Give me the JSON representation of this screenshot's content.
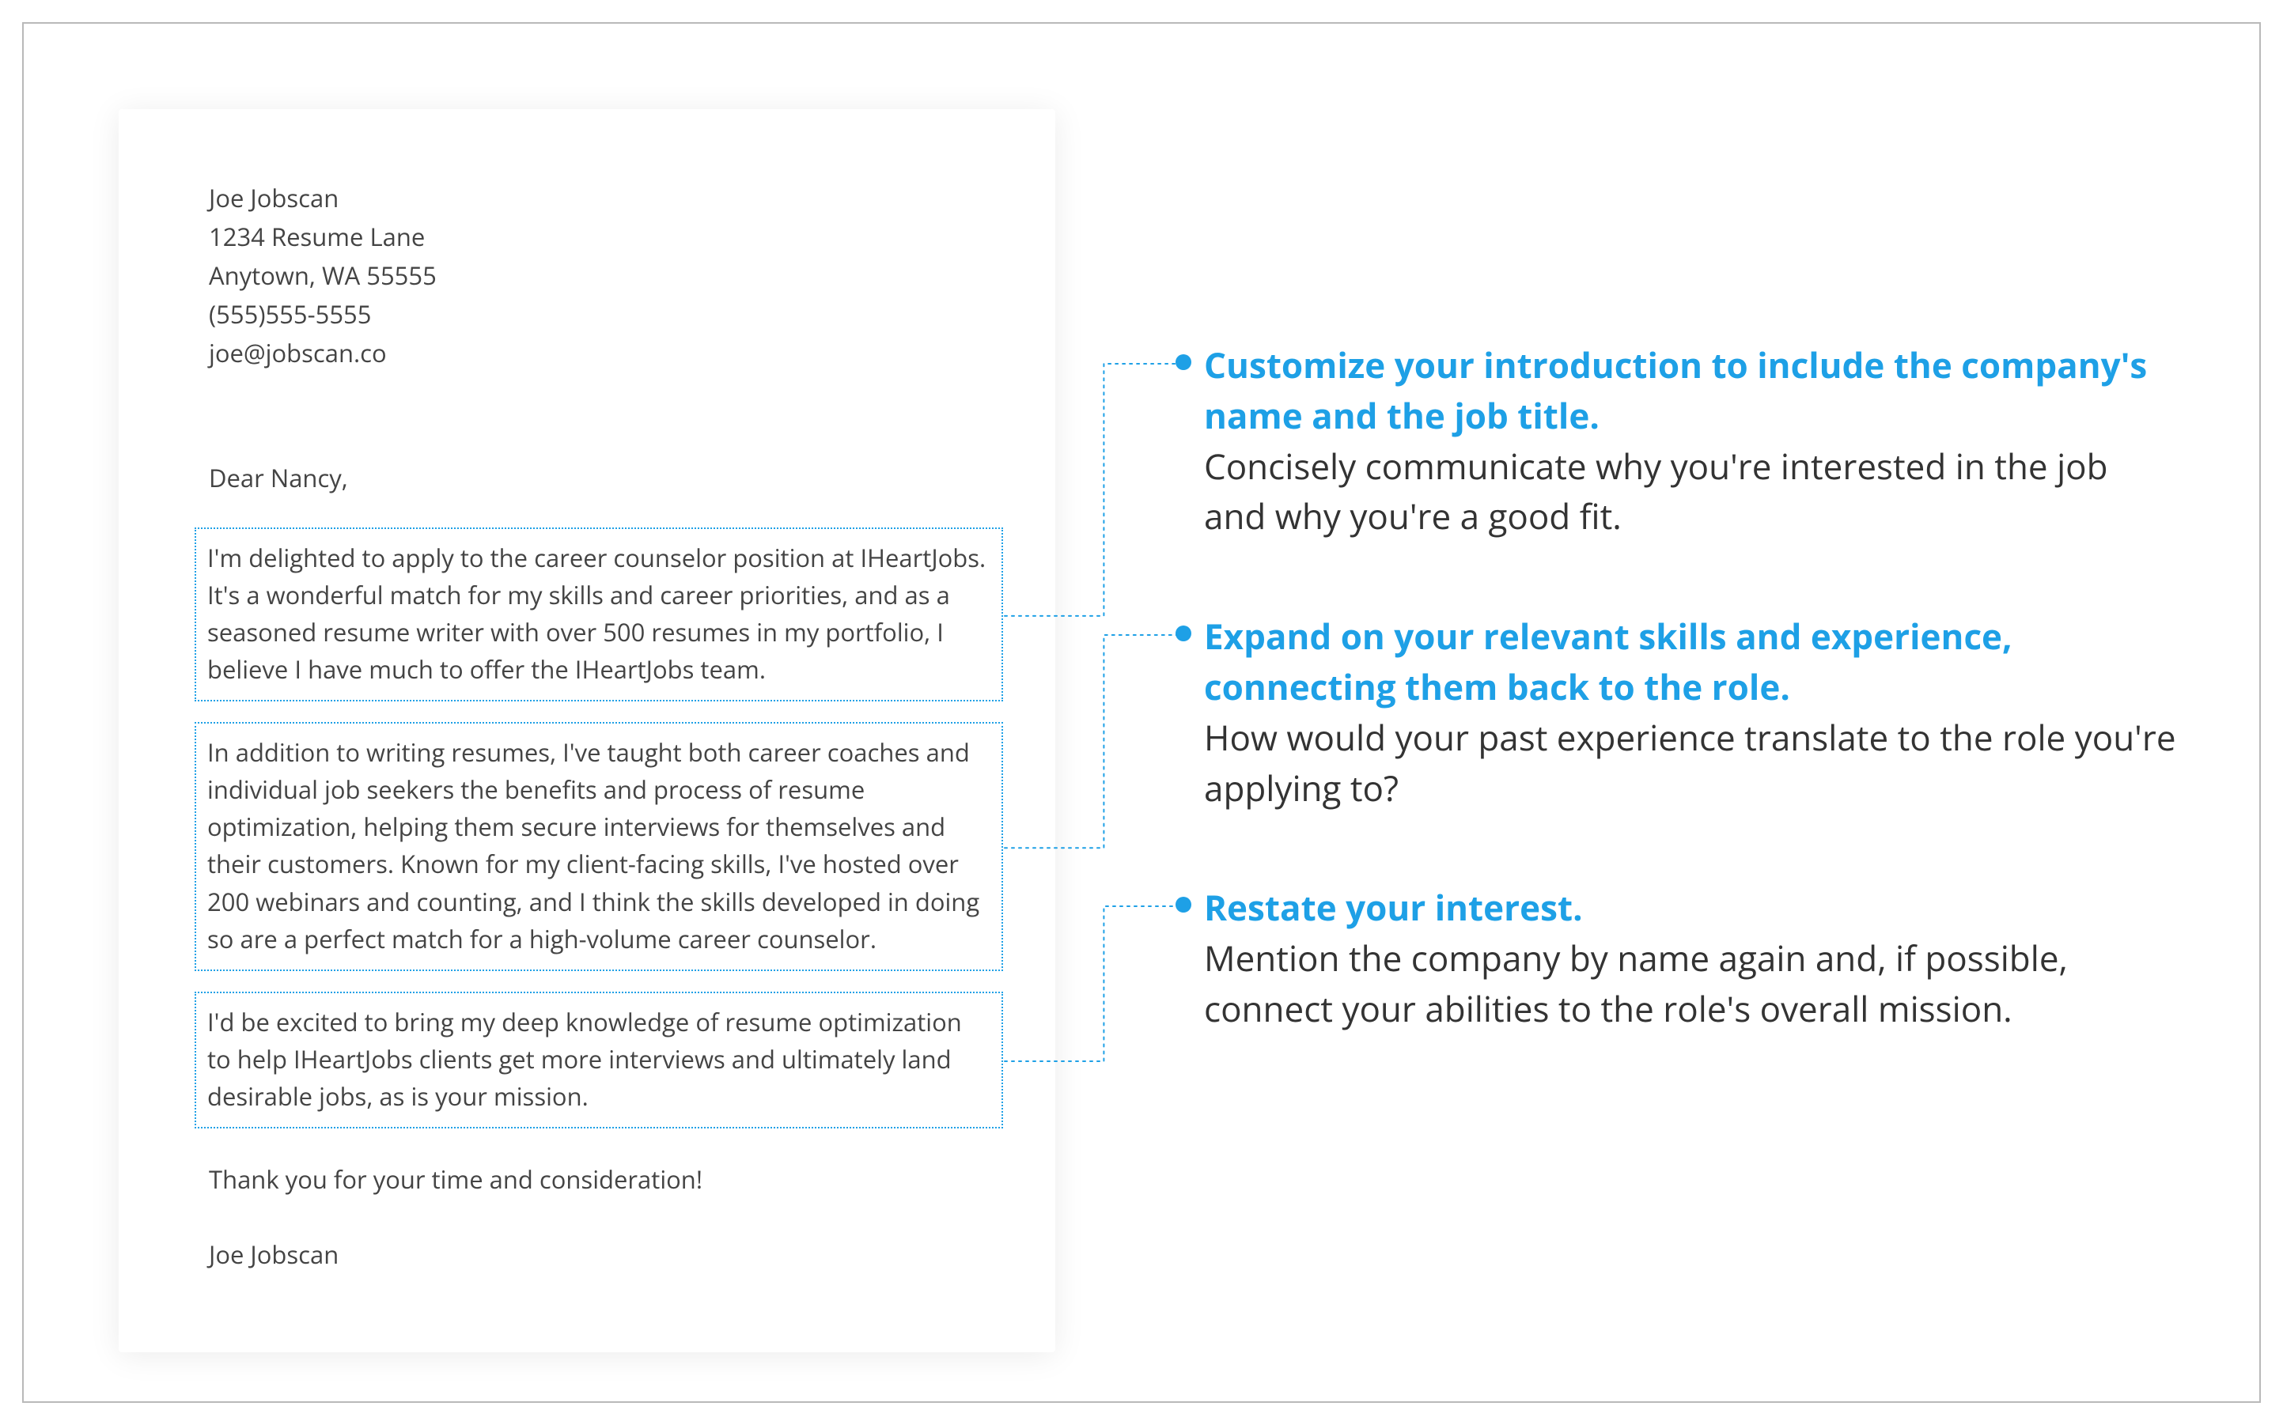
{
  "letter": {
    "header": {
      "name": "Joe Jobscan",
      "address1": "1234 Resume Lane",
      "address2": "Anytown, WA 55555",
      "phone": "(555)555-5555",
      "email": "joe@jobscan.co"
    },
    "salutation": "Dear Nancy,",
    "paragraphs": [
      "I'm delighted to apply to the career counselor position at IHeartJobs. It's a wonderful match for my skills and career priorities, and as a seasoned resume writer with over 500 resumes in my portfolio, I believe I have much to offer the IHeartJobs team.",
      "In addition to writing resumes, I've taught both career coaches and individual job seekers the benefits and process of resume optimization, helping them secure interviews for themselves and their customers. Known for my client-facing skills, I've hosted over 200 webinars and counting, and I think the skills developed in doing so are a perfect match for a high-volume career counselor.",
      "I'd be excited to bring my deep knowledge of resume optimization to help IHeartJobs clients get more interviews and ultimately land desirable jobs, as is your mission."
    ],
    "thanks": "Thank you for your time and consideration!",
    "signoff": "Joe Jobscan"
  },
  "tips": [
    {
      "title": "Customize your introduction to include the company's name and the job title.",
      "body": "Concisely communicate why you're interested in the job and why you're a good fit."
    },
    {
      "title": "Expand on your relevant skills and experience, connecting them back to the role.",
      "body": "How would your past experience translate to the role you're applying to?"
    },
    {
      "title": "Restate your interest.",
      "body": "Mention the company by name again and, if possible, connect your abilities to the role's overall mission."
    }
  ]
}
